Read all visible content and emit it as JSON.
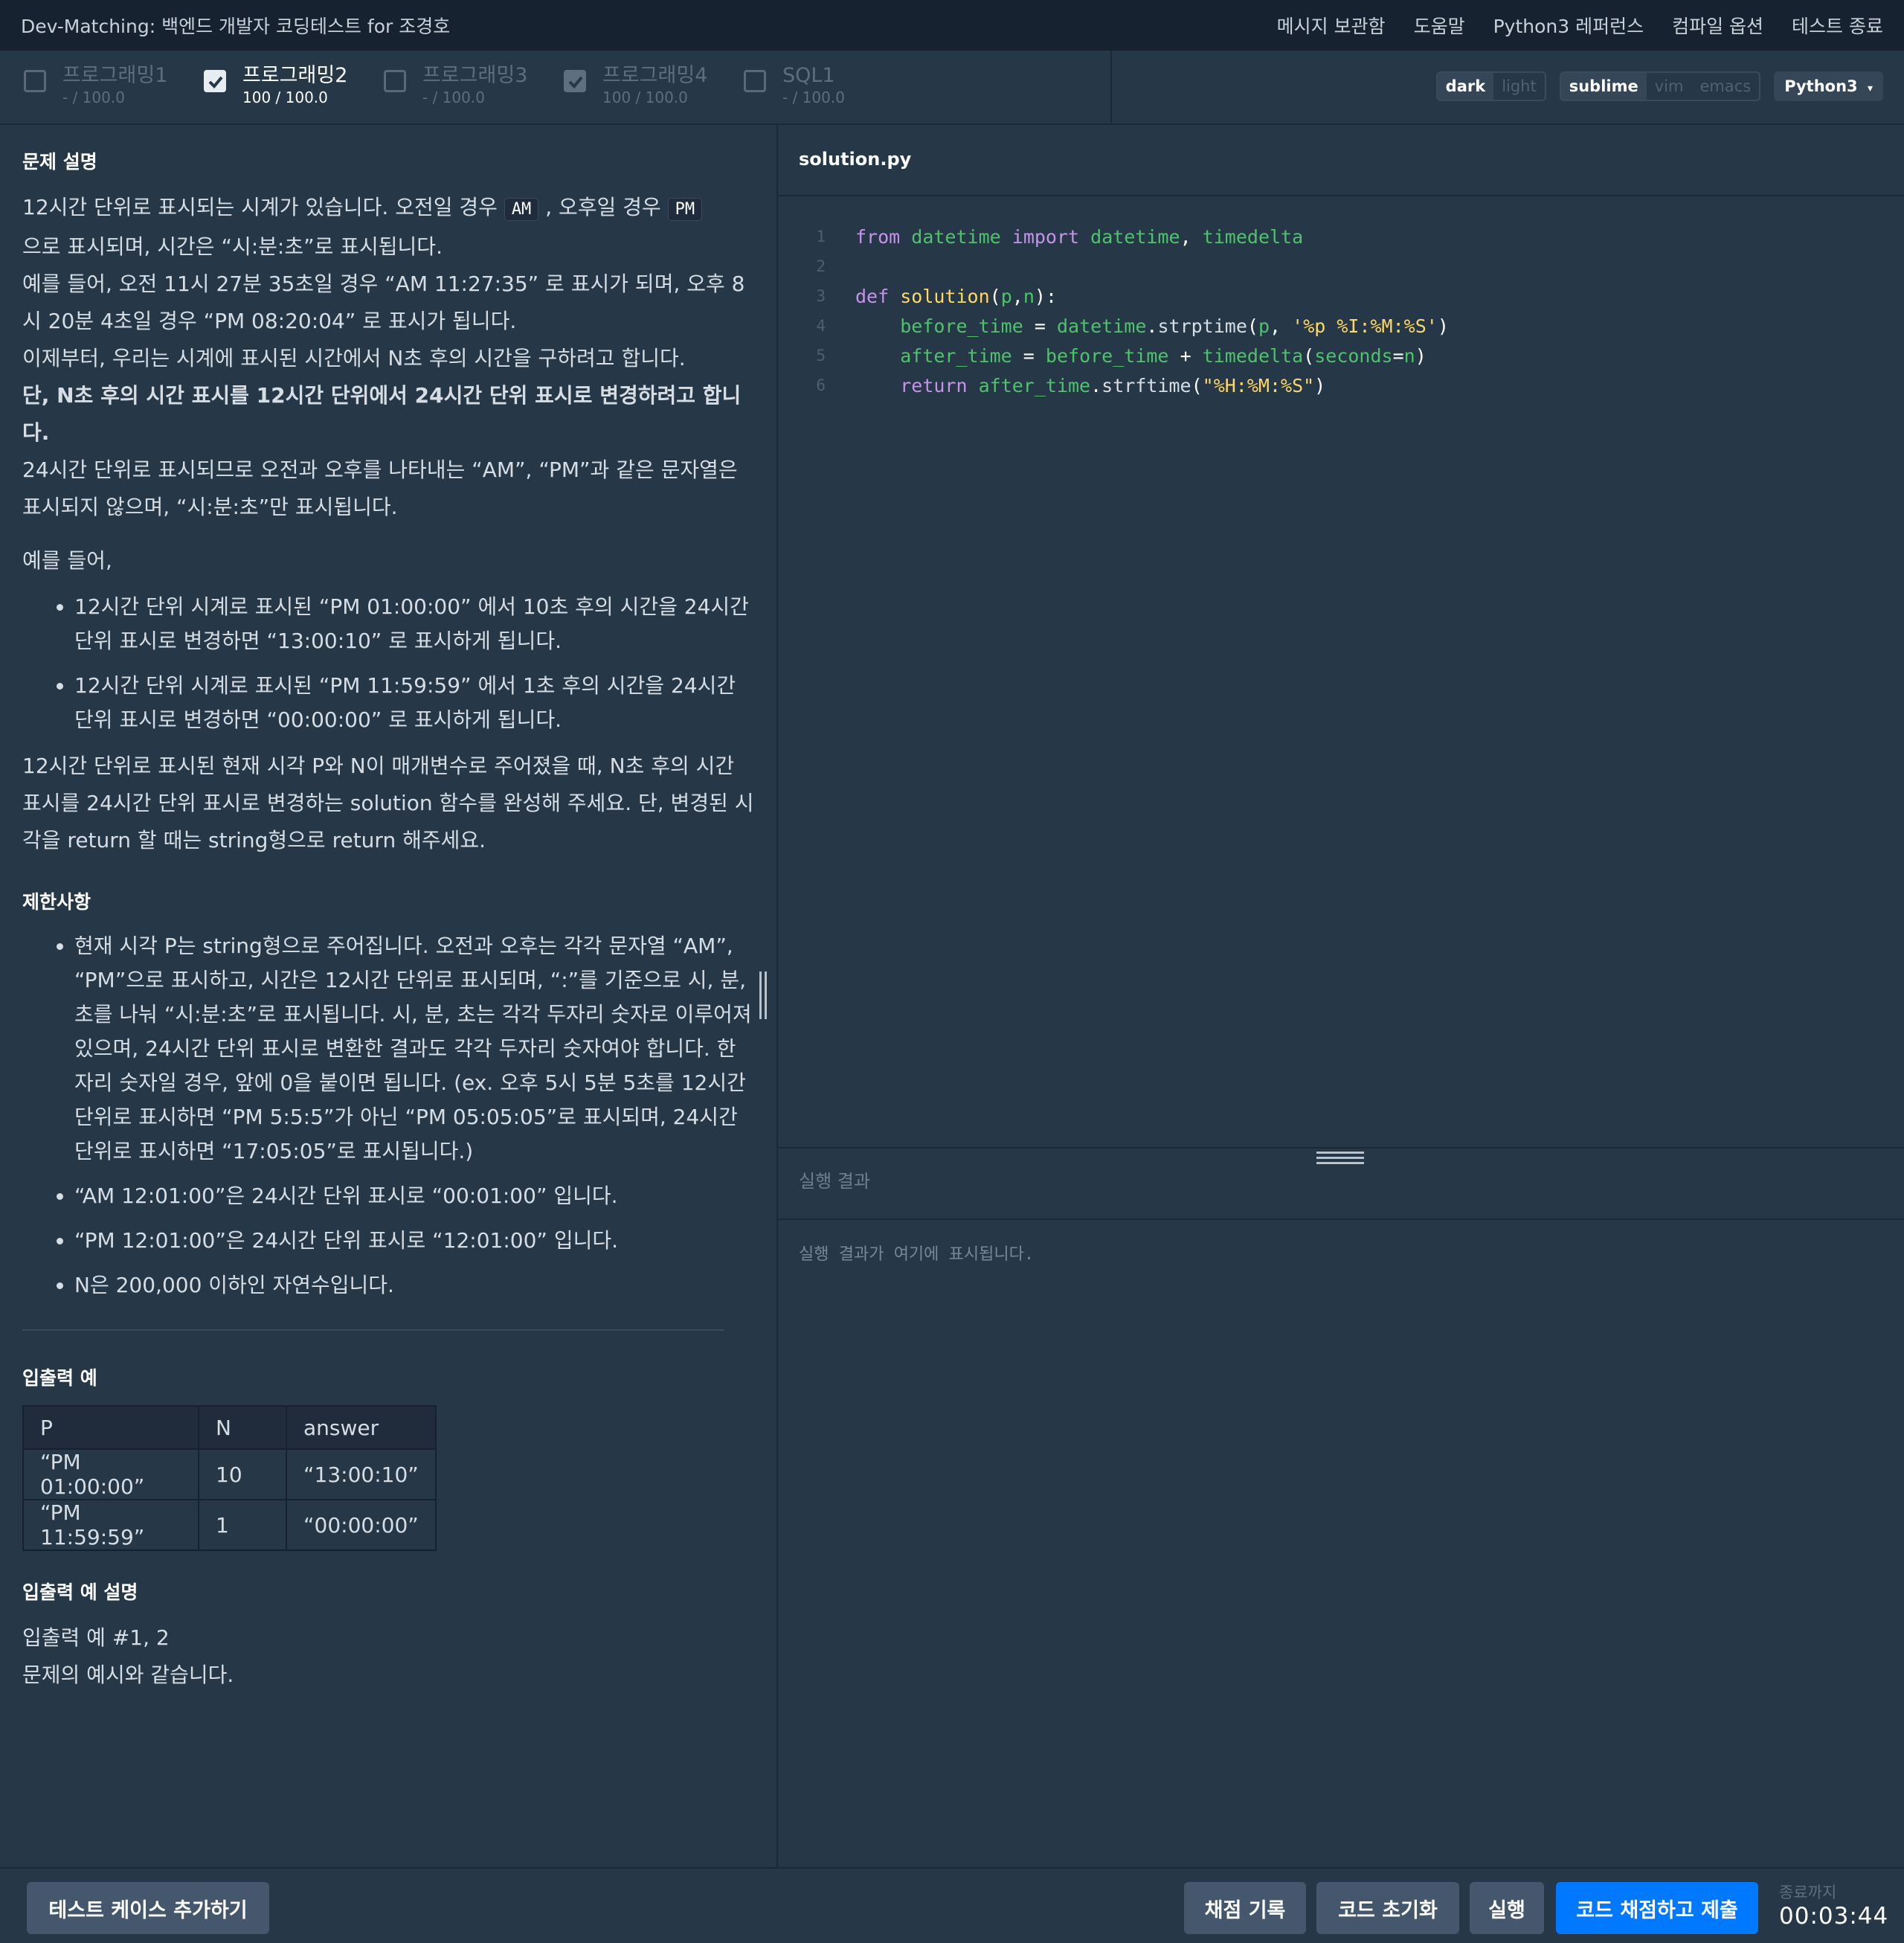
{
  "header": {
    "title": "Dev-Matching: 백엔드 개발자 코딩테스트 for 조경호",
    "menu": [
      "메시지 보관함",
      "도움말",
      "Python3 레퍼런스",
      "컴파일 옵션",
      "테스트 종료"
    ]
  },
  "tabs": [
    {
      "name": "프로그래밍1",
      "score": "- / 100.0",
      "checked": false
    },
    {
      "name": "프로그래밍2",
      "score": "100 / 100.0",
      "checked": true
    },
    {
      "name": "프로그래밍3",
      "score": "- / 100.0",
      "checked": false
    },
    {
      "name": "프로그래밍4",
      "score": "100 / 100.0",
      "checked": true
    },
    {
      "name": "SQL1",
      "score": "- / 100.0",
      "checked": false
    }
  ],
  "options": {
    "theme": [
      "dark",
      "light"
    ],
    "keymap": [
      "sublime",
      "vim",
      "emacs"
    ],
    "language": "Python3"
  },
  "problem": {
    "heading": "문제 설명",
    "intro1a": "12시간 단위로 표시되는 시계가 있습니다. 오전일 경우",
    "am": "AM",
    "intro1b": ", 오후일 경우",
    "pm": "PM",
    "intro1c": "으로 표시되며, 시간은 “시:분:초”로 표시됩니다.",
    "intro2": "예를 들어, 오전 11시 27분 35초일 경우 “AM 11:27:35” 로 표시가 되며, 오후 8시 20분 4초일 경우 “PM 08:20:04” 로 표시가 됩니다.",
    "intro3": "이제부터, 우리는 시계에 표시된 시간에서 N초 후의 시간을 구하려고 합니다.",
    "intro4": "단, N초 후의 시간 표시를 12시간 단위에서 24시간 단위 표시로 변경하려고 합니다.",
    "intro5": "24시간 단위로 표시되므로 오전과 오후를 나타내는 “AM”, “PM”과 같은 문자열은 표시되지 않으며, “시:분:초”만 표시됩니다.",
    "example_intro": "예를 들어,",
    "examples": [
      "12시간 단위 시계로 표시된 “PM 01:00:00” 에서 10초 후의 시간을 24시간 단위 표시로 변경하면 “13:00:10” 로 표시하게 됩니다.",
      "12시간 단위 시계로 표시된 “PM 11:59:59” 에서 1초 후의 시간을 24시간 단위 표시로 변경하면 “00:00:00” 로 표시하게 됩니다."
    ],
    "task": "12시간 단위로 표시된 현재 시각 P와 N이 매개변수로 주어졌을 때, N초 후의 시간 표시를 24시간 단위 표시로 변경하는 solution 함수를 완성해 주세요. 단, 변경된 시각을 return 할 때는 string형으로 return 해주세요.",
    "constraints_heading": "제한사항",
    "constraints": [
      "현재 시각 P는 string형으로 주어집니다. 오전과 오후는 각각 문자열 “AM”, “PM”으로 표시하고, 시간은 12시간 단위로 표시되며, “:”를 기준으로 시, 분, 초를 나눠 “시:분:초”로 표시됩니다. 시, 분, 초는 각각 두자리 숫자로 이루어져 있으며, 24시간 단위 표시로 변환한 결과도 각각 두자리 숫자여야 합니다. 한자리 숫자일 경우, 앞에 0을 붙이면 됩니다. (ex. 오후 5시 5분 5초를 12시간 단위로 표시하면 “PM 5:5:5”가 아닌 “PM 05:05:05”로 표시되며, 24시간 단위로 표시하면 “17:05:05”로 표시됩니다.)",
      "“AM 12:01:00”은 24시간 단위 표시로 “00:01:00” 입니다.",
      "“PM 12:01:00”은 24시간 단위 표시로 “12:01:00” 입니다.",
      "N은 200,000 이하인 자연수입니다."
    ],
    "io_heading": "입출력 예",
    "io_headers": [
      "P",
      "N",
      "answer"
    ],
    "io_rows": [
      [
        "“PM 01:00:00”",
        "10",
        "“13:00:10”"
      ],
      [
        "“PM 11:59:59”",
        "1",
        "“00:00:00”"
      ]
    ],
    "io_explain_heading": "입출력 예 설명",
    "io_explain1": "입출력 예 #1, 2",
    "io_explain2": "문제의 예시와 같습니다."
  },
  "editor": {
    "filename": "solution.py",
    "line_numbers": [
      "1",
      "2",
      "3",
      "4",
      "5",
      "6"
    ]
  },
  "result": {
    "heading": "실행 결과",
    "placeholder": "실행 결과가 여기에 표시됩니다."
  },
  "bottom": {
    "add_testcase": "테스트 케이스 추가하기",
    "history": "채점 기록",
    "reset": "코드 초기화",
    "run": "실행",
    "submit": "코드 채점하고 제출",
    "timer_label": "종료까지",
    "timer": "00:03:44"
  },
  "colors": {
    "background": "#263747",
    "topbar": "#172230",
    "primary": "#0078ff",
    "keyword": "#c792ea",
    "identifier": "#4fc36b",
    "string": "#ffd866"
  }
}
